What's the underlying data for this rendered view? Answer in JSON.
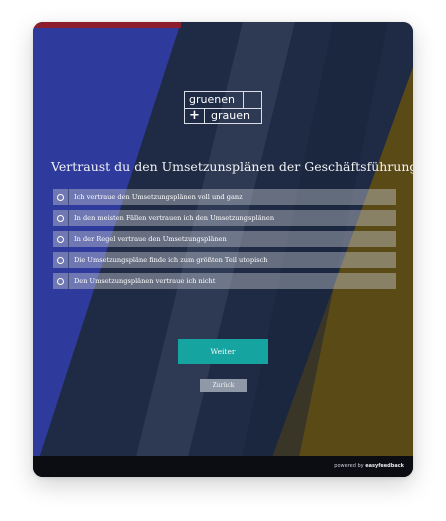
{
  "colors": {
    "page_background": "#ffffff",
    "panel_blue": "#2f3b9c",
    "panel_navy": "#1f2a44",
    "panel_olive": "#5a4a16",
    "top_bar_red": "#8b1d2c",
    "option_background": "rgba(200,205,212,0.42)",
    "weiter_button": "#16a4a0",
    "zurueck_button": "#8f98a6",
    "footer": "#0b0d12"
  },
  "logo": {
    "line1": "gruenen",
    "plus": "+",
    "line2": "grauen"
  },
  "survey": {
    "question": "Vertraust du den Umsetzunsplänen der Geschäftsführung?",
    "options": [
      {
        "label": "Ich vertraue den Umsetzungsplänen voll und ganz",
        "selected": false
      },
      {
        "label": "In den meisten Fällen vertrauen ich den Umsetzungsplänen",
        "selected": false
      },
      {
        "label": "In der Regel vertraue den Umsetzungsplänen",
        "selected": false
      },
      {
        "label": "Die Umsetzungspläne finde ich zum größten Teil utopisch",
        "selected": false
      },
      {
        "label": "Den Umsetzungsplänen vertraue ich nicht",
        "selected": false
      }
    ],
    "next_label": "Weiter",
    "back_label": "Zurück"
  },
  "footer": {
    "powered_prefix": "powered by",
    "brand": "easyfeedback"
  },
  "icons": {
    "radio": "radio-circle-icon"
  }
}
